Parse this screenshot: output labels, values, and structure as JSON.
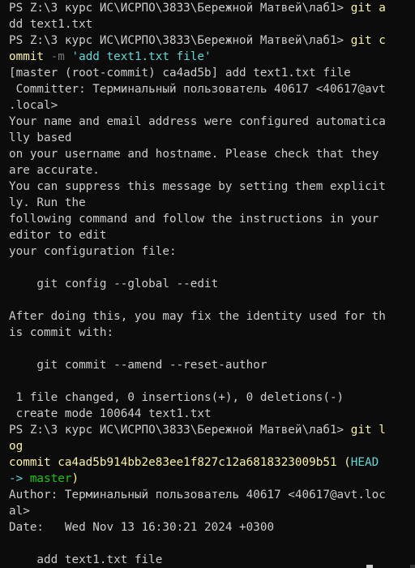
{
  "colors": {
    "background": "#0c0c0c",
    "text": "#cccccc",
    "command": "#f9f1a5",
    "flag": "#767676",
    "string": "#61d6d6",
    "commit_hash": "#f9f1a5",
    "head": "#61d6d6",
    "branch": "#16c60c"
  },
  "lines": [
    [
      {
        "t": "PS Z:\\3 курс ИС\\ИСРПО\\3833\\Бережной Матвей\\лаб1> "
      },
      {
        "t": "git a",
        "c": "yellow"
      }
    ],
    [
      {
        "t": "dd text1.txt"
      }
    ],
    [
      {
        "t": "PS Z:\\3 курс ИС\\ИСРПО\\3833\\Бережной Матвей\\лаб1> "
      },
      {
        "t": "git c",
        "c": "yellow"
      }
    ],
    [
      {
        "t": "ommit ",
        "c": "yellow"
      },
      {
        "t": "-m ",
        "c": "gray"
      },
      {
        "t": "'add text1.txt file'",
        "c": "cyan"
      }
    ],
    [
      {
        "t": "[master (root-commit) ca4ad5b] add text1.txt file"
      }
    ],
    [
      {
        "t": " Committer: Терминальный пользователь 40617 <40617@avt"
      }
    ],
    [
      {
        "t": ".local>"
      }
    ],
    [
      {
        "t": "Your name and email address were configured automatica"
      }
    ],
    [
      {
        "t": "lly based"
      }
    ],
    [
      {
        "t": "on your username and hostname. Please check that they"
      }
    ],
    [
      {
        "t": "are accurate."
      }
    ],
    [
      {
        "t": "You can suppress this message by setting them explicit"
      }
    ],
    [
      {
        "t": "ly. Run the"
      }
    ],
    [
      {
        "t": "following command and follow the instructions in your"
      }
    ],
    [
      {
        "t": "editor to edit"
      }
    ],
    [
      {
        "t": "your configuration file:"
      }
    ],
    [
      {
        "t": ""
      }
    ],
    [
      {
        "t": "    git config --global --edit"
      }
    ],
    [
      {
        "t": ""
      }
    ],
    [
      {
        "t": "After doing this, you may fix the identity used for th"
      }
    ],
    [
      {
        "t": "is commit with:"
      }
    ],
    [
      {
        "t": ""
      }
    ],
    [
      {
        "t": "    git commit --amend --reset-author"
      }
    ],
    [
      {
        "t": ""
      }
    ],
    [
      {
        "t": " 1 file changed, 0 insertions(+), 0 deletions(-)"
      }
    ],
    [
      {
        "t": " create mode 100644 text1.txt"
      }
    ],
    [
      {
        "t": "PS Z:\\3 курс ИС\\ИСРПО\\3833\\Бережной Матвей\\лаб1> "
      },
      {
        "t": "git l",
        "c": "yellow"
      }
    ],
    [
      {
        "t": "og",
        "c": "yellow"
      }
    ],
    [
      {
        "t": "commit ca4ad5b914bb2e83ee1f827c12a6818323009b51 ",
        "c": "yellow"
      },
      {
        "t": "(",
        "c": "yellow"
      },
      {
        "t": "HEAD",
        "c": "cyan"
      }
    ],
    [
      {
        "t": "-> ",
        "c": "cyan"
      },
      {
        "t": "master",
        "c": "green"
      },
      {
        "t": ")",
        "c": "yellow"
      }
    ],
    [
      {
        "t": "Author: Терминальный пользователь 40617 <40617@avt.loc"
      }
    ],
    [
      {
        "t": "al>"
      }
    ],
    [
      {
        "t": "Date:   Wed Nov 13 16:30:21 2024 +0300"
      }
    ],
    [
      {
        "t": ""
      }
    ],
    [
      {
        "t": "    add text1.txt file"
      }
    ]
  ]
}
